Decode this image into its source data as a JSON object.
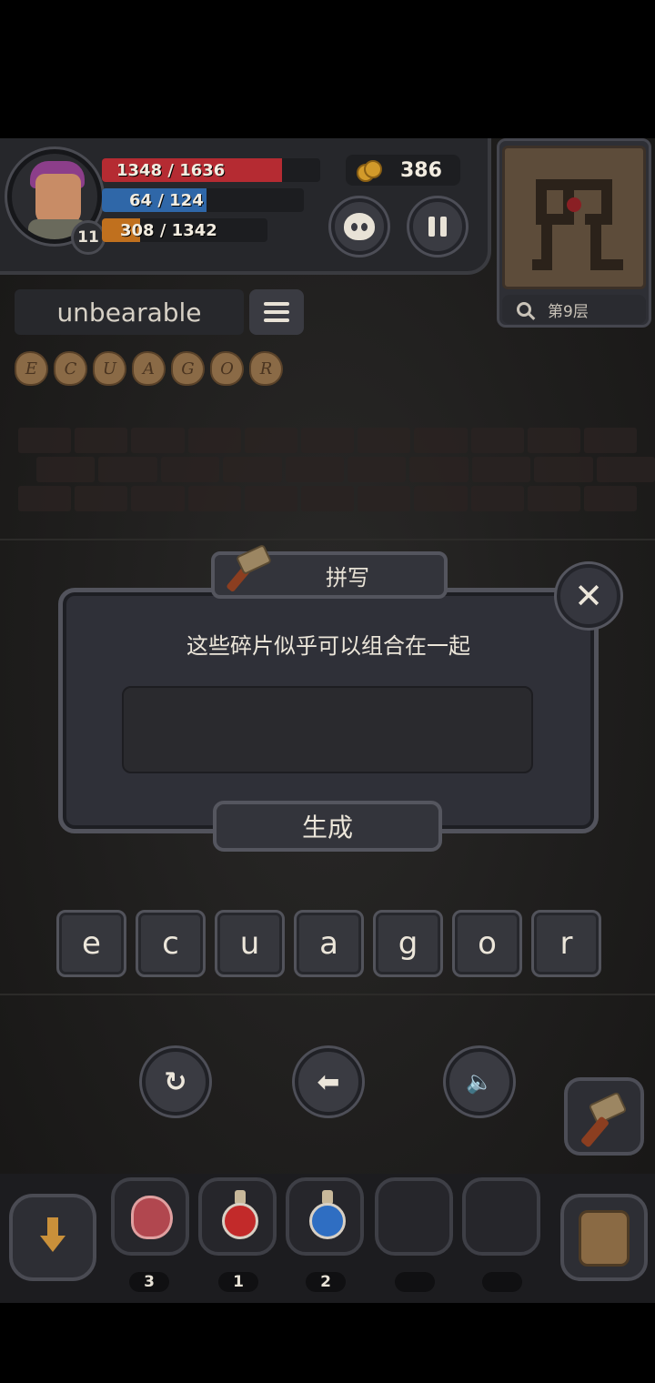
{
  "player": {
    "level": "11",
    "hp_text": "1348 / 1636",
    "hp_fraction": 0.824,
    "mp_text": "64 / 124",
    "mp_fraction": 0.516,
    "xp_text": "308 / 1342",
    "xp_fraction": 0.23
  },
  "gold": {
    "amount": "386"
  },
  "map": {
    "floor_label": "第9层"
  },
  "word": {
    "current": "unbearable"
  },
  "fragments": [
    "E",
    "C",
    "U",
    "A",
    "G",
    "O",
    "R"
  ],
  "dialog": {
    "title": "拼写",
    "message": "这些碎片似乎可以组合在一起",
    "answer_value": "",
    "generate_label": "生成",
    "close_label": "✕"
  },
  "letter_tiles": [
    "e",
    "c",
    "u",
    "a",
    "g",
    "o",
    "r"
  ],
  "controls": {
    "undo_glyph": "↻",
    "back_glyph": "⬅",
    "sound_glyph": "🔈"
  },
  "inventory": [
    {
      "icon": "meat-icon",
      "count": "3"
    },
    {
      "icon": "red-potion-icon",
      "count": "1"
    },
    {
      "icon": "blue-potion-icon",
      "count": "2"
    },
    {
      "icon": "empty-slot",
      "count": ""
    },
    {
      "icon": "empty-slot",
      "count": ""
    }
  ],
  "colors": {
    "hp": "#b52b32",
    "mp": "#2f67a8",
    "xp": "#c0701e",
    "red_potion": "#c22a2a",
    "blue_potion": "#2f6ec2"
  }
}
